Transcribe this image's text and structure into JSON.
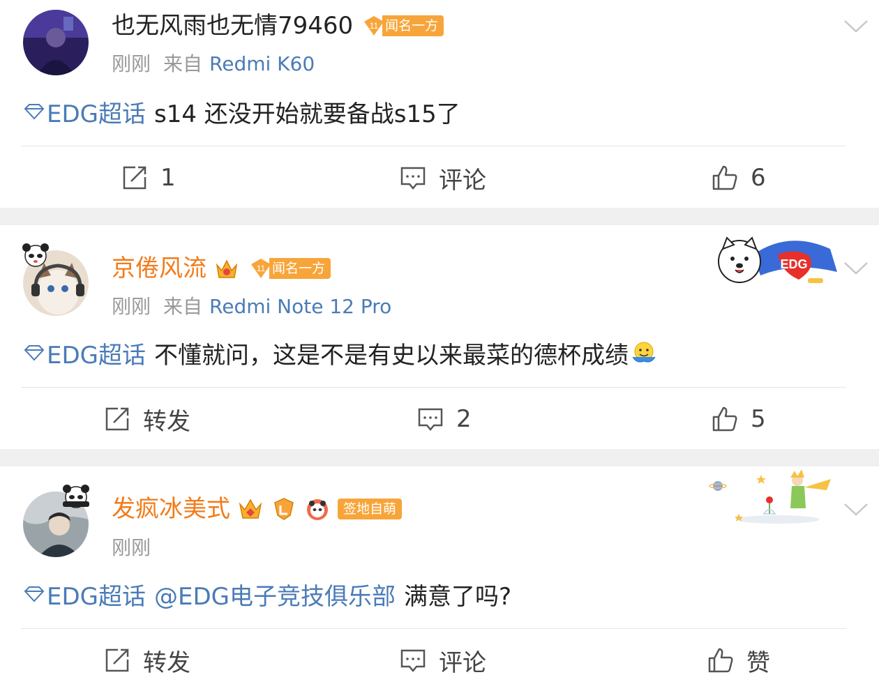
{
  "posts": [
    {
      "username": "也无风雨也无情79460",
      "fame_badge": "闻名一方",
      "time": "刚刚",
      "from_label": "来自",
      "device": "Redmi K60",
      "topic": "EDG超话",
      "text": "s14 还没开始就要备战s15了",
      "actions": {
        "repost": "1",
        "comment": "评论",
        "like": "6"
      }
    },
    {
      "username": "京倦风流",
      "fame_badge": "闻名一方",
      "time": "刚刚",
      "from_label": "来自",
      "device": "Redmi Note 12 Pro",
      "topic": "EDG超话",
      "text": "不懂就问，这是不是有史以来最菜的德杯成绩",
      "decoration_label": "EDG",
      "actions": {
        "repost": "转发",
        "comment": "2",
        "like": "5"
      }
    },
    {
      "username": "发疯冰美式",
      "badge": "签地自萌",
      "time": "刚刚",
      "topic": "EDG超话",
      "mention": "@EDG电子竞技俱乐部",
      "text": "满意了吗?",
      "actions": {
        "repost": "转发",
        "comment": "评论",
        "like": "赞"
      }
    }
  ],
  "colors": {
    "link": "#4a7bb7",
    "vip_name": "#f27b1a",
    "badge": "#f7a53a",
    "separator": "#f0f0f0"
  },
  "icons": [
    "repost-icon",
    "comment-icon",
    "like-icon",
    "chevron-down-icon",
    "topic-diamond-icon"
  ]
}
